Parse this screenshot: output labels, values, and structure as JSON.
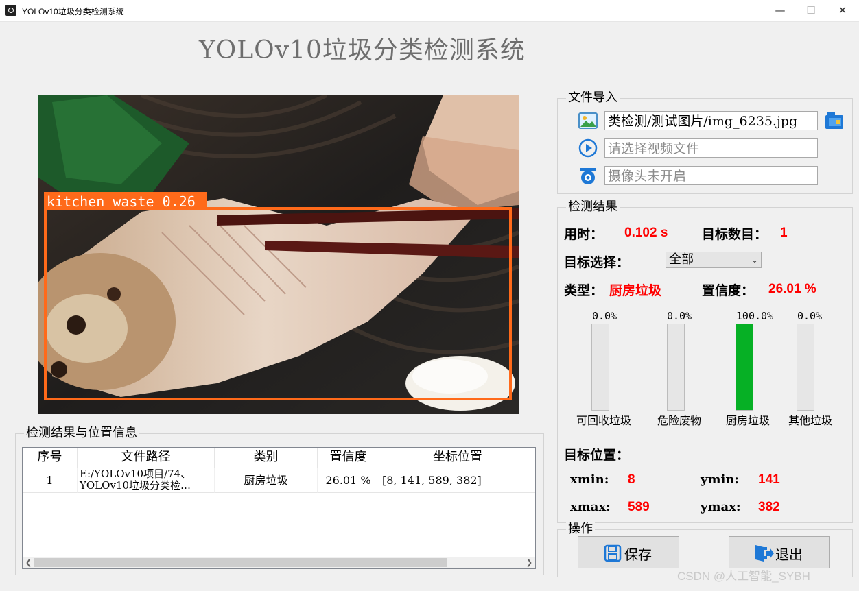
{
  "window": {
    "title": "YOLOv10垃圾分类检测系统",
    "controls": {
      "minimize": "—",
      "maximize": "☐",
      "close": "✕"
    }
  },
  "header": {
    "title": "YOLOv10垃圾分类检测系统"
  },
  "image_view": {
    "detection_label": "kitchen waste 0.26",
    "box_color": "#ff6a1a"
  },
  "file_import": {
    "title": "文件导入",
    "image_path_value": "类检测/测试图片/img_6235.jpg",
    "video_placeholder": "请选择视频文件",
    "camera_placeholder": "摄像头未开启"
  },
  "results": {
    "title": "检测结果",
    "time_label": "用时：",
    "time_value": "0.102 s",
    "count_label": "目标数目：",
    "count_value": "1",
    "select_label": "目标选择：",
    "select_value": "全部",
    "type_label": "类型：",
    "type_value": "厨房垃圾",
    "conf_label": "置信度：",
    "conf_value": "26.01 %",
    "bars": [
      {
        "pct_text": "0.0%",
        "value": 0.0,
        "label": "可回收垃圾"
      },
      {
        "pct_text": "0.0%",
        "value": 0.0,
        "label": "危险废物"
      },
      {
        "pct_text": "100.0%",
        "value": 1.0,
        "label": "厨房垃圾"
      },
      {
        "pct_text": "0.0%",
        "value": 0.0,
        "label": "其他垃圾"
      }
    ],
    "position_title": "目标位置：",
    "xmin_label": "xmin:",
    "xmin_value": "8",
    "ymin_label": "ymin:",
    "ymin_value": "141",
    "xmax_label": "xmax:",
    "xmax_value": "589",
    "ymax_label": "ymax:",
    "ymax_value": "382"
  },
  "operations": {
    "title": "操作",
    "save_label": "保存",
    "exit_label": "退出"
  },
  "table": {
    "title": "检测结果与位置信息",
    "headers": [
      "序号",
      "文件路径",
      "类别",
      "置信度",
      "坐标位置"
    ],
    "rows": [
      {
        "index": "1",
        "path_line1": "E:/YOLOv10项目/74、",
        "path_line2": "YOLOv10垃圾分类检…",
        "category": "厨房垃圾",
        "confidence": "26.01 %",
        "coords": "[8, 141, 589, 382]"
      }
    ]
  },
  "watermark": "CSDN @人工智能_SYBH",
  "colors": {
    "accent_red": "#ff0000",
    "bar_green": "#06b025",
    "icon_blue": "#1e78d6"
  }
}
